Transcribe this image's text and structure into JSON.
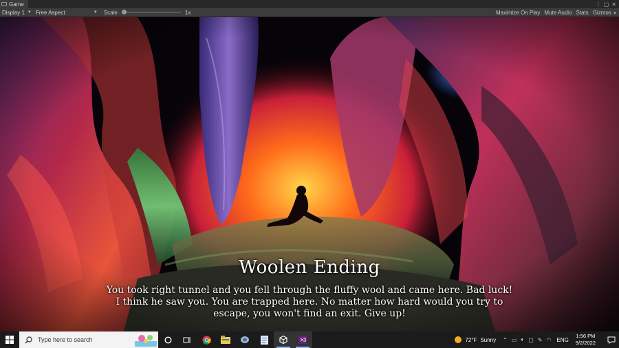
{
  "editor": {
    "tab_label": "Game",
    "tab_controls": [
      "⋮",
      "▢",
      "✕"
    ],
    "toolbar": {
      "display": "Display 1",
      "aspect": "Free Aspect",
      "scale_label": "Scale",
      "scale_value": "1x",
      "scale_level": 0.0,
      "maximize_on_play": "Maximize On Play",
      "mute_audio": "Mute Audio",
      "stats": "Stats",
      "gizmos": "Gizmos"
    }
  },
  "game": {
    "title": "Woolen Ending",
    "body": "You took right tunnel and you fell through the fluffy wool and came here. Bad luck! I think he saw you. You are trapped here. No matter how hard would you try to escape, you won't find an exit. Give up!",
    "palette": {
      "glow": "#ff6a1a",
      "red": "#e02040",
      "purple": "#6a3ca8",
      "green": "#3fae5a",
      "blue": "#2f6cff"
    }
  },
  "taskbar": {
    "search_placeholder": "Type here to search",
    "apps": [
      "cortana-icon",
      "task-view-icon",
      "chrome-icon",
      "file-explorer-icon",
      "app-icon",
      "notepad-icon",
      "unity-icon",
      "visual-studio-icon"
    ],
    "weather_temp": "72°F",
    "weather_desc": "Sunny",
    "language": "ENG",
    "time": "1:56 PM",
    "date": "9/2/2022"
  }
}
